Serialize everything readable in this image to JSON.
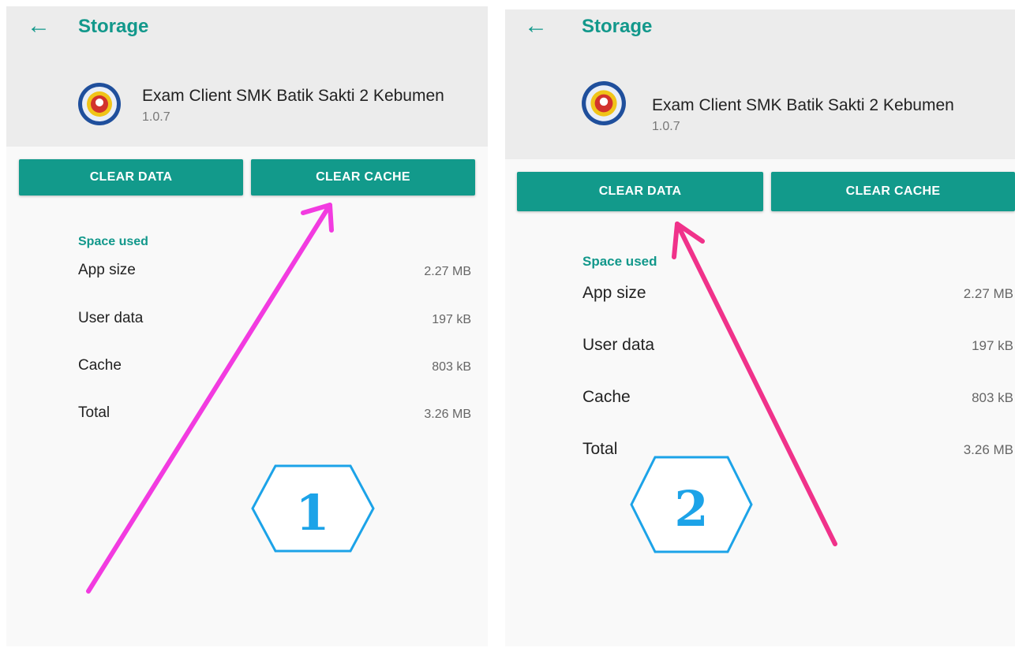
{
  "panels": [
    {
      "header": {
        "back_icon": "arrow-back-icon",
        "title": "Storage"
      },
      "app": {
        "name": "Exam Client SMK Batik Sakti 2 Kebumen",
        "version": "1.0.7",
        "logo_icon": "school-logo-icon"
      },
      "buttons": {
        "clear_data": "CLEAR DATA",
        "clear_cache": "CLEAR CACHE"
      },
      "space": {
        "title": "Space used",
        "rows": [
          {
            "label": "App size",
            "value": "2.27 MB"
          },
          {
            "label": "User data",
            "value": "197 kB"
          },
          {
            "label": "Cache",
            "value": "803 kB"
          },
          {
            "label": "Total",
            "value": "3.26 MB"
          }
        ]
      },
      "annotation": {
        "number": "1",
        "arrow_color": "#f23be0"
      }
    },
    {
      "header": {
        "back_icon": "arrow-back-icon",
        "title": "Storage"
      },
      "app": {
        "name": "Exam Client SMK Batik Sakti 2 Kebumen",
        "version": "1.0.7",
        "logo_icon": "school-logo-icon"
      },
      "buttons": {
        "clear_data": "CLEAR DATA",
        "clear_cache": "CLEAR CACHE"
      },
      "space": {
        "title": "Space used",
        "rows": [
          {
            "label": "App size",
            "value": "2.27 MB"
          },
          {
            "label": "User data",
            "value": "197 kB"
          },
          {
            "label": "Cache",
            "value": "803 kB"
          },
          {
            "label": "Total",
            "value": "3.26 MB"
          }
        ]
      },
      "annotation": {
        "number": "2",
        "arrow_color": "#f0328a"
      }
    }
  ],
  "colors": {
    "accent": "#12988b",
    "button": "#129a8b",
    "header_bg": "#ececec",
    "page_bg": "#f9f9f9",
    "badge": "#1ca3e8"
  }
}
